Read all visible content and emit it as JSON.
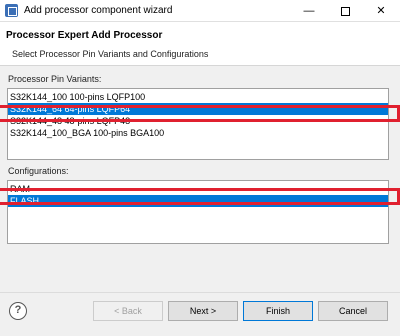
{
  "window": {
    "title": "Add processor component wizard",
    "minimize": "—",
    "close": "✕"
  },
  "header": {
    "title": "Processor Expert Add Processor",
    "subtitle": "Select Processor Pin Variants and Configurations"
  },
  "pin_variants": {
    "label": "Processor Pin Variants:",
    "items": [
      {
        "label": "S32K144_100 100-pins LQFP100",
        "selected": false
      },
      {
        "label": "S32K144_64 64-pins LQFP64",
        "selected": true
      },
      {
        "label": "S32K144_48 48-pins LQFP48",
        "selected": false
      },
      {
        "label": "S32K144_100_BGA 100-pins BGA100",
        "selected": false
      }
    ]
  },
  "configurations": {
    "label": "Configurations:",
    "items": [
      {
        "label": "RAM",
        "selected": false
      },
      {
        "label": "FLASH",
        "selected": true
      }
    ]
  },
  "footer": {
    "help": "?",
    "back_label": "< Back",
    "next_label": "Next >",
    "finish_label": "Finish",
    "cancel_label": "Cancel"
  },
  "colors": {
    "selection": "#0078d7",
    "annotation": "#e0202f"
  }
}
